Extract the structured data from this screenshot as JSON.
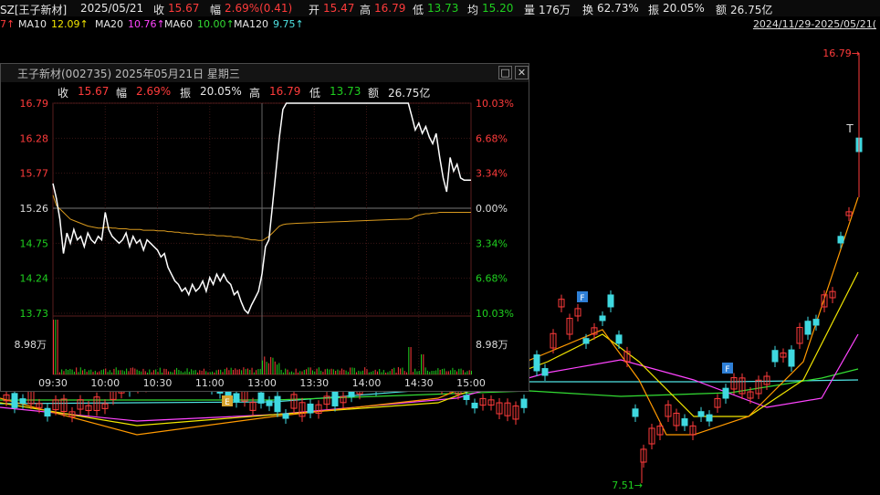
{
  "header": {
    "symbol": "SZ[王子新材]",
    "date": "2025/05/21",
    "close_label": "收",
    "close_value": "15.67",
    "change_label": "幅",
    "change_value": "2.69%(0.41)",
    "open_label": "开",
    "open_value": "15.47",
    "high_label": "高",
    "high_value": "16.79",
    "low_label": "低",
    "low_value": "13.73",
    "avg_label": "均",
    "avg_value": "15.20",
    "volume_label": "量",
    "volume_value": "176万",
    "turnover_label": "换",
    "turnover_value": "62.73%",
    "amplitude_label": "振",
    "amplitude_value": "20.05%",
    "amount_label": "额",
    "amount_value": "26.75亿"
  },
  "ma_bar": {
    "ma5_tail": "7↑",
    "ma10_label": "MA10",
    "ma10_value": "12.09↑",
    "ma20_label": "MA20",
    "ma20_value": "10.76↑",
    "ma60_label": "MA60",
    "ma60_value": "10.00↑",
    "ma120_label": "MA120",
    "ma120_value": "9.75↑",
    "date_range": "2024/11/29-2025/05/21(",
    "colors": {
      "ma10": "#f2e600",
      "ma20": "#ff44ff",
      "ma60": "#33dd33",
      "ma120": "#4fe3e3"
    }
  },
  "kline": {
    "high_marker": "16.79→",
    "low_marker": "7.51→",
    "t_marker": "T",
    "f_badge_1": "F",
    "f_badge_2": "F",
    "f_badge_3": "F",
    "e_badge": "E"
  },
  "popup": {
    "title": "王子新材(002735) 2025年05月21日 星期三",
    "close_label": "收",
    "close_value": "15.67",
    "change_label": "幅",
    "change_value": "2.69%",
    "amplitude_label": "振",
    "amplitude_value": "20.05%",
    "high_label": "高",
    "high_value": "16.79",
    "low_label": "低",
    "low_value": "13.73",
    "amount_label": "额",
    "amount_value": "26.75亿",
    "restore_icon": "□",
    "close_icon": "✕"
  },
  "chart_data": [
    {
      "type": "line",
      "prev_close": 15.26,
      "ylim": [
        13.73,
        16.79
      ],
      "y_ticks_left": [
        "16.79",
        "16.28",
        "15.77",
        "15.26",
        "14.75",
        "14.24",
        "13.73"
      ],
      "y_ticks_right": [
        "10.03%",
        "6.68%",
        "3.34%",
        "0.00%",
        "3.34%",
        "6.68%",
        "10.03%"
      ],
      "volume_max_label": "8.98万",
      "x_ticks": [
        "09:30",
        "10:00",
        "10:30",
        "11:00",
        "11:30",
        "13:00",
        "13:30",
        "14:00",
        "14:30",
        "15:00"
      ],
      "price_t": [
        0,
        2,
        4,
        6,
        8,
        10,
        12,
        14,
        16,
        18,
        20,
        22,
        24,
        26,
        28,
        30,
        32,
        34,
        36,
        38,
        40,
        42,
        44,
        46,
        48,
        50,
        52,
        54,
        56,
        58,
        60,
        62,
        64,
        66,
        68,
        70,
        72,
        74,
        76,
        78,
        80,
        82,
        84,
        86,
        88,
        90,
        92,
        94,
        96,
        98,
        100,
        102,
        104,
        106,
        108,
        110,
        112,
        114,
        116,
        118,
        120,
        121,
        122,
        124,
        126,
        128,
        130,
        132,
        134,
        140,
        150,
        160,
        170,
        180,
        190,
        200,
        204,
        206,
        208,
        210,
        212,
        214,
        216,
        218,
        220,
        222,
        224,
        226,
        228,
        230,
        232,
        234,
        236,
        238,
        240
      ],
      "price": [
        15.62,
        15.4,
        15.1,
        14.6,
        14.9,
        14.75,
        14.95,
        14.8,
        14.85,
        14.7,
        14.9,
        14.8,
        14.75,
        14.85,
        14.8,
        15.2,
        14.95,
        14.85,
        14.8,
        14.75,
        14.8,
        14.9,
        14.7,
        14.85,
        14.75,
        14.8,
        14.65,
        14.8,
        14.75,
        14.7,
        14.65,
        14.55,
        14.6,
        14.4,
        14.3,
        14.2,
        14.15,
        14.05,
        14.1,
        14.0,
        14.15,
        14.05,
        14.1,
        14.2,
        14.05,
        14.25,
        14.15,
        14.3,
        14.2,
        14.3,
        14.2,
        14.15,
        14.0,
        14.05,
        13.9,
        13.78,
        13.73,
        13.85,
        13.95,
        14.05,
        14.3,
        14.5,
        14.7,
        14.8,
        15.3,
        15.8,
        16.3,
        16.7,
        16.79,
        16.79,
        16.79,
        16.79,
        16.79,
        16.79,
        16.79,
        16.79,
        16.79,
        16.6,
        16.4,
        16.5,
        16.35,
        16.45,
        16.3,
        16.2,
        16.35,
        16.0,
        15.7,
        15.5,
        16.0,
        15.8,
        15.9,
        15.7,
        15.67,
        15.67,
        15.67
      ],
      "avg": [
        15.45,
        15.3,
        15.25,
        15.2,
        15.15,
        15.1,
        15.08,
        15.06,
        15.04,
        15.02,
        15.0,
        14.99,
        14.98,
        14.97,
        14.97,
        14.98,
        14.98,
        14.97,
        14.97,
        14.96,
        14.96,
        14.96,
        14.95,
        14.95,
        14.95,
        14.95,
        14.94,
        14.94,
        14.94,
        14.94,
        14.93,
        14.93,
        14.93,
        14.92,
        14.92,
        14.91,
        14.91,
        14.9,
        14.9,
        14.89,
        14.89,
        14.88,
        14.88,
        14.88,
        14.87,
        14.87,
        14.87,
        14.86,
        14.86,
        14.86,
        14.85,
        14.85,
        14.84,
        14.84,
        14.83,
        14.82,
        14.81,
        14.8,
        14.8,
        14.79,
        14.79,
        14.8,
        14.82,
        14.85,
        14.9,
        14.95,
        15.0,
        15.02,
        15.03,
        15.04,
        15.05,
        15.06,
        15.07,
        15.08,
        15.09,
        15.1,
        15.1,
        15.11,
        15.14,
        15.16,
        15.17,
        15.18,
        15.18,
        15.19,
        15.19,
        15.2,
        15.2,
        15.2,
        15.2,
        15.2,
        15.2,
        15.2,
        15.2,
        15.2,
        15.2
      ]
    },
    {
      "type": "candlestick",
      "price_high": 16.79,
      "price_low": 7.51
    }
  ]
}
